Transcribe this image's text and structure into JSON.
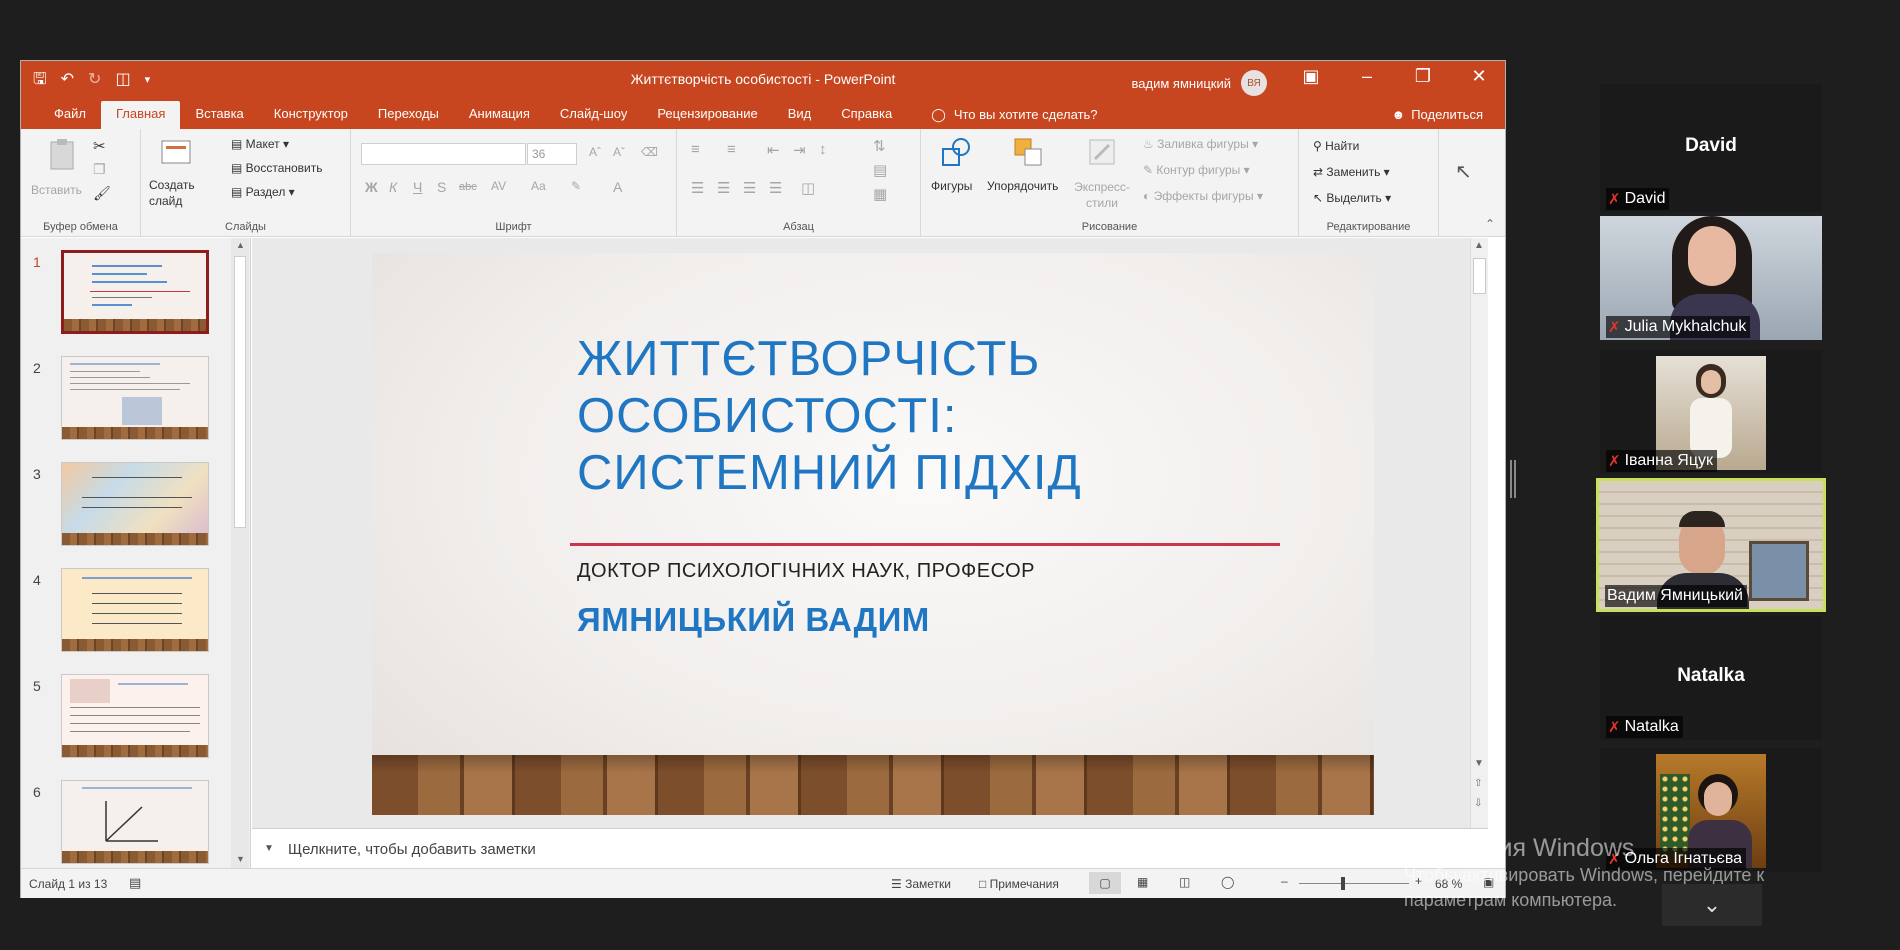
{
  "window": {
    "doc_title": "Життєтворчість особистості  -  PowerPoint",
    "user_name": "вадим ямницкий",
    "user_initials": "ВЯ"
  },
  "ribbon_tabs": [
    "Файл",
    "Главная",
    "Вставка",
    "Конструктор",
    "Переходы",
    "Анимация",
    "Слайд-шоу",
    "Рецензирование",
    "Вид",
    "Справка"
  ],
  "active_tab": "Главная",
  "tell_me": "Что вы хотите сделать?",
  "share_label": "Поделиться",
  "ribbon": {
    "clipboard": {
      "paste": "Вставить",
      "label": "Буфер обмена"
    },
    "slides": {
      "new_slide": "Создать слайд",
      "layout": "Макет",
      "reset": "Восстановить",
      "section": "Раздел",
      "label": "Слайды"
    },
    "font": {
      "size": "36",
      "label": "Шрифт",
      "bold": "Ж",
      "italic": "К",
      "underline": "Ч",
      "shadow": "S",
      "strike": "abc",
      "spacing": "AV",
      "case": "Aa",
      "color": "A"
    },
    "paragraph": {
      "label": "Абзац"
    },
    "drawing": {
      "shapes": "Фигуры",
      "arrange": "Упорядочить",
      "quick_styles": "Экспресс-стили",
      "fill": "Заливка фигуры",
      "outline": "Контур фигуры",
      "effects": "Эффекты фигуры",
      "label": "Рисование"
    },
    "editing": {
      "find": "Найти",
      "replace": "Заменить",
      "select": "Выделить",
      "label": "Редактирование"
    }
  },
  "thumbnails": [
    "1",
    "2",
    "3",
    "4",
    "5",
    "6"
  ],
  "slide": {
    "title_line1": "ЖИТТЄТВОРЧІСТЬ",
    "title_line2": "ОСОБИСТОСТІ:",
    "title_line3": "СИСТЕМНИЙ ПІДХІД",
    "subtitle": "ДОКТОР ПСИХОЛОГІЧНИХ НАУК, ПРОФЕСОР",
    "author": "ЯМНИЦЬКИЙ ВАДИМ"
  },
  "notes_placeholder": "Щелкните, чтобы добавить заметки",
  "statusbar": {
    "slide_count": "Слайд 1 из 13",
    "notes": "Заметки",
    "comments": "Примечания",
    "zoom": "68 %"
  },
  "participants": [
    {
      "name": "David",
      "video": false
    },
    {
      "name": "Julia Mykhalchuk",
      "video": true
    },
    {
      "name": "Іванна Яцук",
      "video": true
    },
    {
      "name": "Вадим Ямницький",
      "video": true,
      "speaking": true
    },
    {
      "name": "Natalka",
      "video": false
    },
    {
      "name": "Ольга Ігнатьєва",
      "video": true
    }
  ],
  "activation": {
    "title": "Активация Windows",
    "subtitle_line1": "Чтобы активировать Windows, перейдите к",
    "subtitle_line2": "параметрам компьютера."
  },
  "colors": {
    "accent": "#c7461f",
    "slide_title": "#1f76c2",
    "rule": "#c8364d",
    "speaking_border": "#c8e05a"
  }
}
